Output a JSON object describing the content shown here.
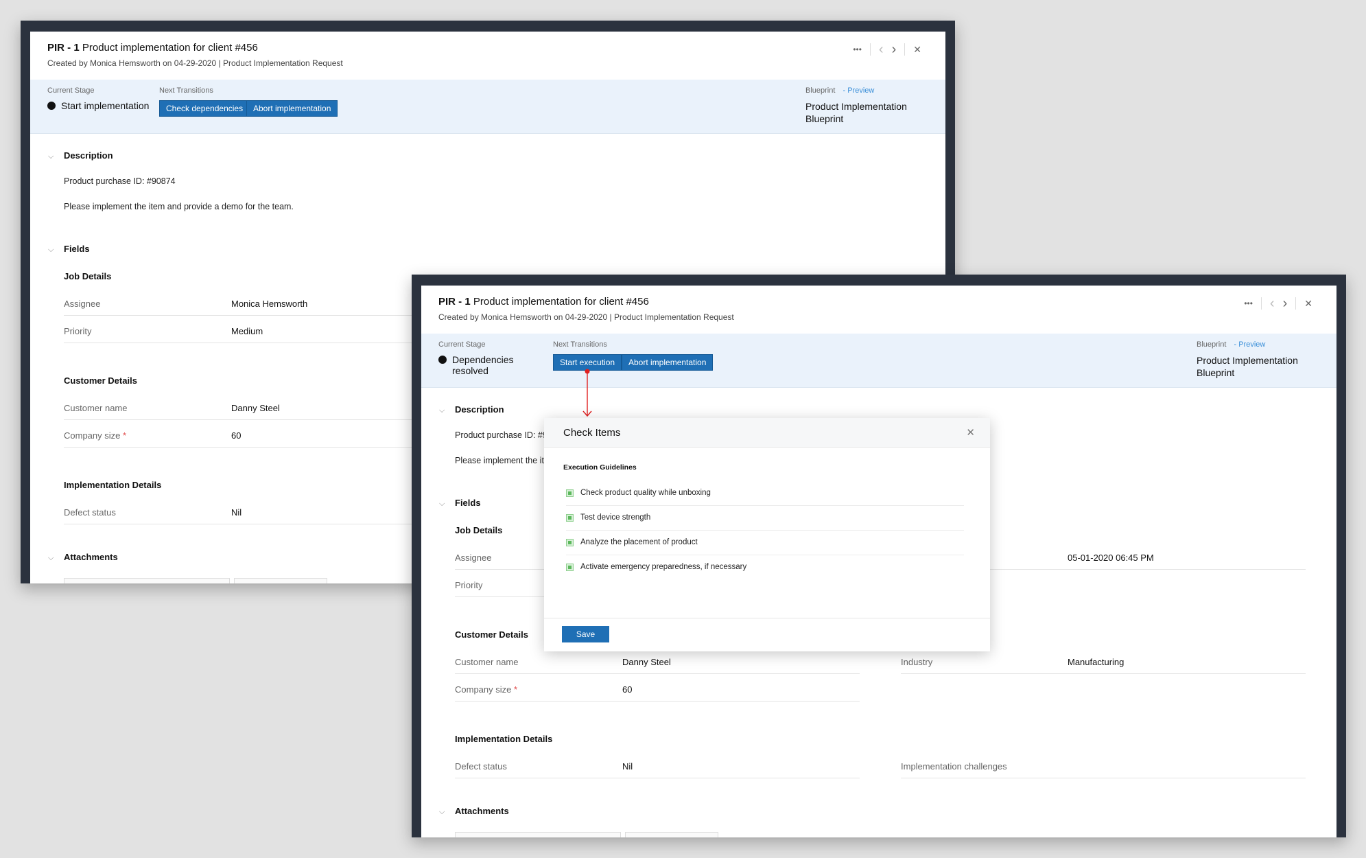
{
  "record": {
    "id": "PIR - 1",
    "title": "Product implementation for client #456",
    "created_prefix": "Created by",
    "created_by": "Monica Hemsworth",
    "created_on": "on 04-29-2020",
    "layout": "| Product Implementation Request"
  },
  "toolbar": {
    "more": "•••",
    "prev": "‹",
    "next": "›",
    "close": "✕"
  },
  "labels": {
    "current_stage": "Current Stage",
    "next_transitions": "Next Transitions",
    "blueprint": "Blueprint",
    "preview": "- Preview",
    "description": "Description",
    "fields": "Fields",
    "job_details": "Job Details",
    "assignee": "Assignee",
    "priority": "Priority",
    "customer_details": "Customer Details",
    "customer_name": "Customer name",
    "company_size": "Company size",
    "required_mark": "*",
    "industry": "Industry",
    "implementation_details": "Implementation Details",
    "defect_status": "Defect status",
    "implementation_challenges": "Implementation challenges",
    "attachments": "Attachments"
  },
  "back_window": {
    "current_stage": "Start implementation",
    "transitions": [
      "Check dependencies",
      "Abort implementation"
    ],
    "blueprint_line1": "Product Implementation",
    "blueprint_line2": "Blueprint"
  },
  "front_window": {
    "current_stage_line1": "Dependencies",
    "current_stage_line2": "resolved",
    "transitions": [
      "Start execution",
      "Abort implementation"
    ],
    "blueprint_line1": "Product Implementation",
    "blueprint_line2": "Blueprint"
  },
  "description": {
    "line1": "Product purchase ID: #90874",
    "line2": "Please implement the item and provide a demo for the team.",
    "front_line1": "Product purchase ID: #9",
    "front_line2": "Please implement the ite"
  },
  "values": {
    "assignee": "Monica Hemsworth",
    "priority": "Medium",
    "due_datetime": "05-01-2020 06:45 PM",
    "customer_name": "Danny Steel",
    "company_size": "60",
    "industry": "Manufacturing",
    "defect_status": "Nil"
  },
  "modal": {
    "title": "Check Items",
    "section": "Execution Guidelines",
    "items": [
      "Check product quality while unboxing",
      "Test device strength",
      "Analyze the placement of product",
      "Activate emergency preparedness, if necessary"
    ],
    "save": "Save",
    "close": "✕"
  },
  "colors": {
    "accent": "#1f6fb5",
    "stage_bg": "#eaf2fb",
    "frame": "#2b323e",
    "connector": "#e02020",
    "check": "#5cb85c"
  }
}
